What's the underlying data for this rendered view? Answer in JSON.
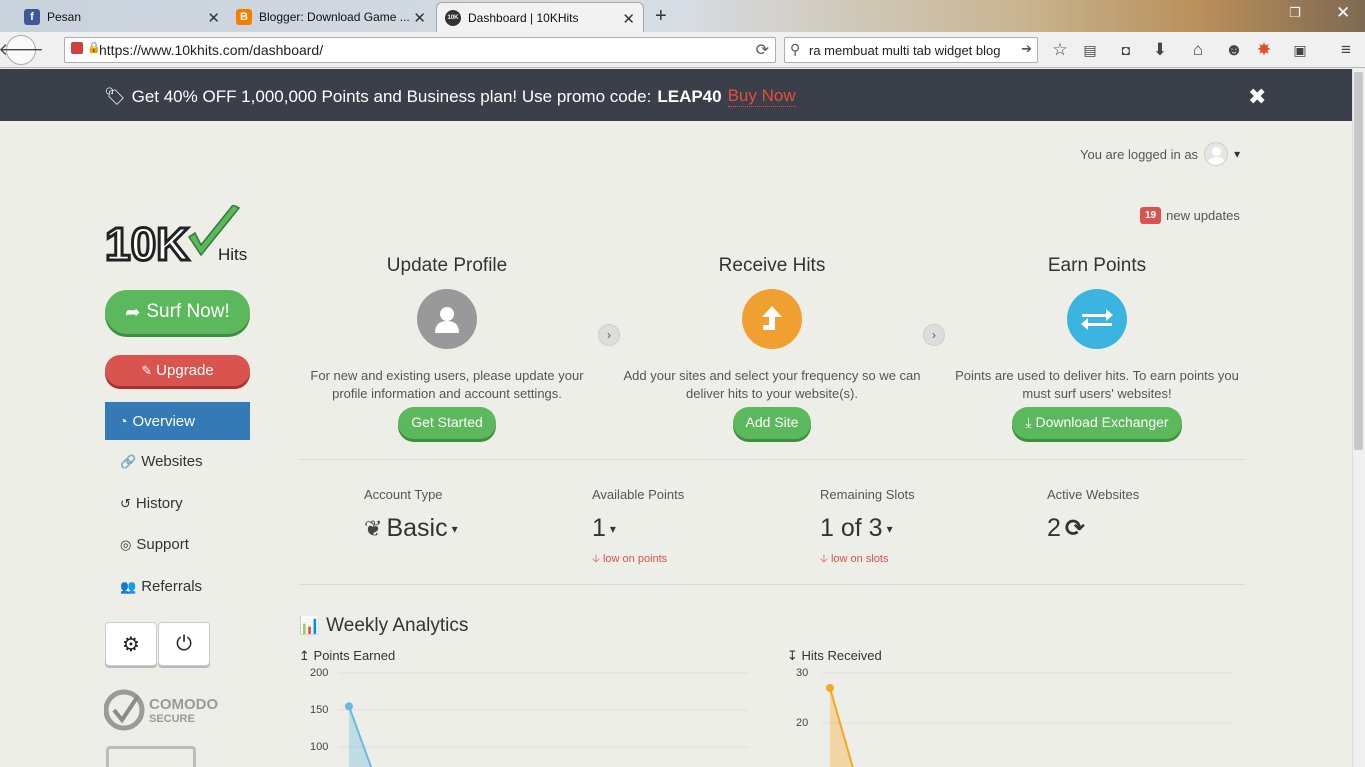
{
  "browser": {
    "tabs": [
      {
        "title": "Pesan",
        "icon": "facebook-icon"
      },
      {
        "title": "Blogger: Download Game ...",
        "icon": "blogger-icon"
      },
      {
        "title": "Dashboard | 10KHits",
        "icon": "10khits-icon"
      }
    ],
    "url": "https://www.10khits.com/dashboard/",
    "search_value": "ra membuat multi tab widget blog"
  },
  "promo": {
    "text": "Get 40% OFF 1,000,000 Points and Business plan! Use promo code:",
    "code": "LEAP40",
    "link": "Buy Now"
  },
  "header": {
    "logged_in_label": "You are logged in as",
    "updates_count": "19",
    "updates_label": "new updates"
  },
  "sidebar": {
    "logo_text": "10K",
    "logo_sub": "Hits",
    "surf_label": "Surf Now!",
    "upgrade_label": "Upgrade",
    "nav": [
      {
        "label": "Overview",
        "icon": "dashboard-icon"
      },
      {
        "label": "Websites",
        "icon": "link-icon"
      },
      {
        "label": "History",
        "icon": "history-icon"
      },
      {
        "label": "Support",
        "icon": "lifebuoy-icon"
      },
      {
        "label": "Referrals",
        "icon": "users-icon"
      }
    ],
    "comodo_line1": "COMODO",
    "comodo_line2": "SECURE"
  },
  "steps": [
    {
      "title": "Update Profile",
      "desc": "For new and existing users, please update your profile information and account settings.",
      "button": "Get Started",
      "icon": "user-icon",
      "color": "#999999"
    },
    {
      "title": "Receive Hits",
      "desc": "Add your sites and select your frequency so we can deliver hits to your website(s).",
      "button": "Add Site",
      "icon": "arrow-up-icon",
      "color": "#f0a030"
    },
    {
      "title": "Earn Points",
      "desc": "Points are used to deliver hits. To earn points you must surf users' websites!",
      "button": "Download Exchanger",
      "icon": "exchange-icon",
      "color": "#3bb4e0"
    }
  ],
  "stats": [
    {
      "label": "Account Type",
      "value": "Basic",
      "warning": ""
    },
    {
      "label": "Available Points",
      "value": "1",
      "warning": "low on points"
    },
    {
      "label": "Remaining Slots",
      "value": "1 of 3",
      "warning": "low on slots"
    },
    {
      "label": "Active Websites",
      "value": "2",
      "warning": ""
    }
  ],
  "analytics": {
    "title": "Weekly Analytics",
    "charts": [
      {
        "title": "Points Earned",
        "ticks": [
          "200",
          "150",
          "100"
        ]
      },
      {
        "title": "Hits Received",
        "ticks": [
          "30",
          "20"
        ]
      }
    ]
  },
  "chart_data": [
    {
      "type": "area",
      "title": "Points Earned",
      "ylim": [
        0,
        200
      ],
      "values": [
        155
      ],
      "color": "#6ab9e0"
    },
    {
      "type": "area",
      "title": "Hits Received",
      "ylim": [
        0,
        30
      ],
      "values": [
        27
      ],
      "color": "#f5a623"
    }
  ]
}
